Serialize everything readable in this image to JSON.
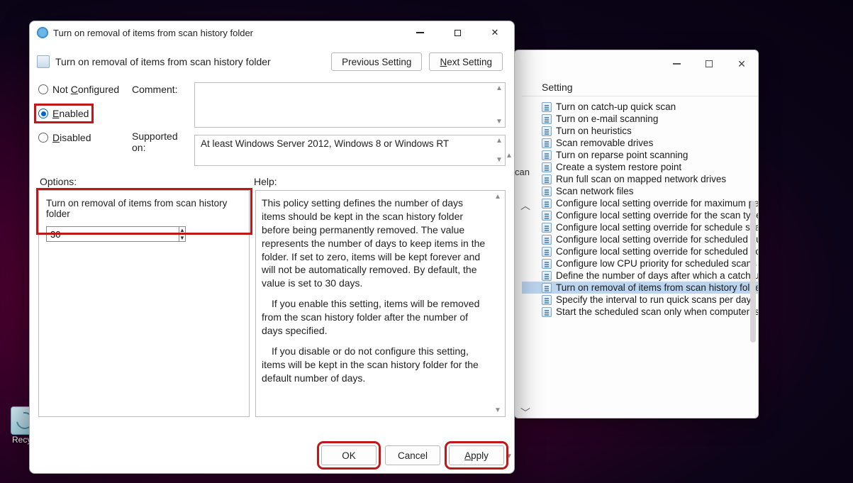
{
  "desktop": {
    "recycle_label": "Recycl"
  },
  "bg_window": {
    "header_col": "Setting",
    "can_fragment": "can",
    "items": [
      "Turn on catch-up quick scan",
      "Turn on e-mail scanning",
      "Turn on heuristics",
      "Scan removable drives",
      "Turn on reparse point scanning",
      "Create a system restore point",
      "Run full scan on mapped network drives",
      "Scan network files",
      "Configure local setting override for maximum perce",
      "Configure local setting override for the scan type to",
      "Configure local setting override for schedule scan da",
      "Configure local setting override for scheduled quick",
      "Configure local setting override for scheduled scan t",
      "Configure low CPU priority for scheduled scans",
      "Define the number of days after which a catch-up sc",
      "Turn on removal of items from scan history folder",
      "Specify the interval to run quick scans per day",
      "Start the scheduled scan only when computer is on b"
    ],
    "selected_index": 15
  },
  "dialog": {
    "title": "Turn on removal of items from scan history folder",
    "subtitle": "Turn on removal of items from scan history folder",
    "nav": {
      "previous": "Previous Setting",
      "next_prefix": "N",
      "next_rest": "ext Setting"
    },
    "radios": {
      "not_configured_prefix": "Not ",
      "not_configured_accel": "C",
      "not_configured_rest": "onfigured",
      "enabled_accel": "E",
      "enabled_rest": "nabled",
      "disabled_accel": "D",
      "disabled_rest": "isabled",
      "selected": "enabled"
    },
    "comment_label": "Comment:",
    "comment_value": "",
    "supported_label": "Supported on:",
    "supported_value": "At least Windows Server 2012, Windows 8 or Windows RT",
    "options_label": "Options:",
    "help_label": "Help:",
    "option_title": "Turn on removal of items from scan history folder",
    "option_value": "30",
    "help_text": {
      "p1": "This policy setting defines the number of days items should be kept in the scan history folder before being permanently removed. The value represents the number of days to keep items in the folder. If set to zero, items will be kept forever and will not be automatically removed. By default, the value is set to 30 days.",
      "p2": "If you enable this setting, items will be removed from the scan history folder after the number of days specified.",
      "p3": "If you disable or do not configure this setting, items will be kept in the scan history folder for the default number of days."
    },
    "footer": {
      "ok": "OK",
      "cancel": "Cancel",
      "apply_accel": "A",
      "apply_rest": "pply"
    }
  }
}
